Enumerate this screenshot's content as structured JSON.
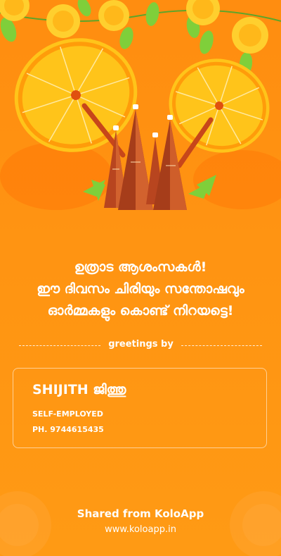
{
  "greeting": {
    "line1": "ഉത്രാട ആശംസകൾ!",
    "line2": "ഈ ദിവസം ചിരിയും സന്തോഷവും",
    "line3": "ഓർമ്മകളും കൊണ്ട് നിറയട്ടെ!"
  },
  "divider_label": "greetings by",
  "card": {
    "name": "SHIJITH ജിത്തു",
    "role": "SELF-EMPLOYED",
    "phone": "PH. 9744615435"
  },
  "footer": {
    "shared": "Shared from KoloApp",
    "url": "www.koloapp.in"
  },
  "colors": {
    "background": "#ff9412",
    "umbrella": "#ffc41a",
    "umbrella_rim": "#ff9c0a",
    "marigold": "#ffcf2e",
    "leaf": "#7fcf3a",
    "pyramid": "#b8451f"
  }
}
